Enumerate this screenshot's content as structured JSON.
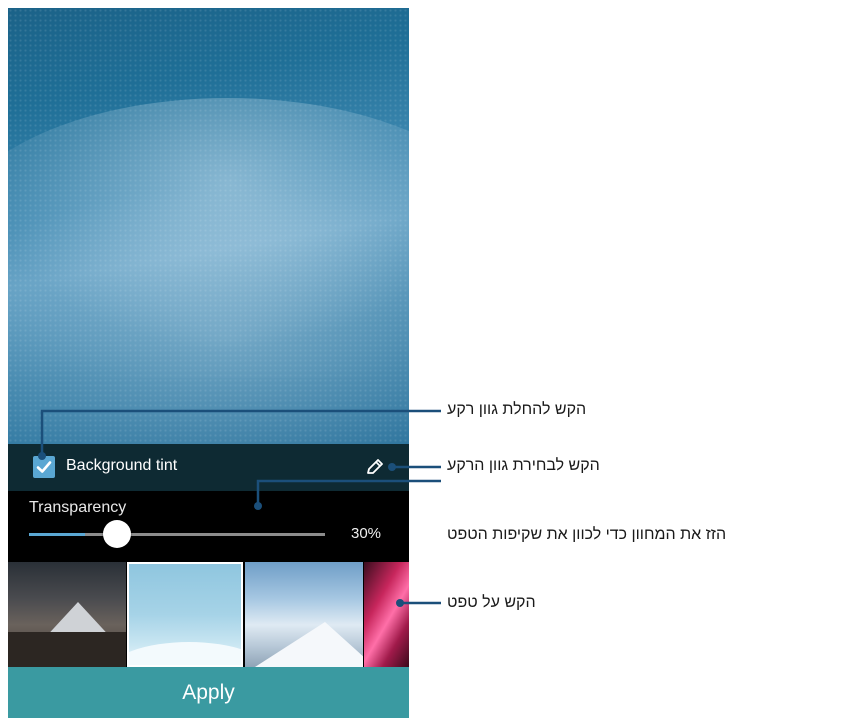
{
  "settings_panel": {
    "tint_checkbox_checked": true,
    "tint_label": "Background tint",
    "transparency_label": "Transparency",
    "transparency_value": "30%",
    "transparency_fraction": 0.3,
    "apply_label": "Apply"
  },
  "colors": {
    "accent": "#5aa7d3",
    "apply_button": "#3a9aa1",
    "tint_bar": "#0e2a33"
  },
  "thumbnails": [
    {
      "name": "mountain-wallpaper",
      "selected": false
    },
    {
      "name": "dune-wallpaper",
      "selected": true
    },
    {
      "name": "snow-wallpaper",
      "selected": false
    },
    {
      "name": "red-abstract-wallpaper",
      "selected": false
    }
  ],
  "callouts": {
    "enable_tint": "הקש להחלת גוון רקע",
    "choose_tint": "הקש לבחירת גוון הרקע",
    "drag_slider": "הזז את המחוון כדי לכוון את שקיפות הטפט",
    "tap_wallpaper": "הקש על טפט"
  },
  "icons": {
    "checkbox": "checkmark-icon",
    "edit": "pencil-icon"
  }
}
